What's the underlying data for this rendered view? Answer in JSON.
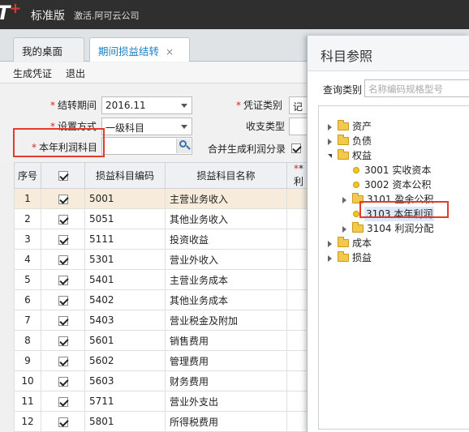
{
  "app": {
    "logo": "T",
    "edition": "标准版",
    "company": "激活.阿可云公司"
  },
  "tabs": [
    {
      "label": "我的桌面"
    },
    {
      "label": "期间损益结转",
      "close": "×"
    }
  ],
  "toolbar": {
    "generate": "生成凭证",
    "exit": "退出"
  },
  "form": {
    "period_label": "结转期间",
    "period_value": "2016.11",
    "voucher_type_label": "凭证类别",
    "voucher_type_value": "记账",
    "setup_label": "设置方式",
    "setup_value": "一级科目",
    "income_type_label": "收支类型",
    "profit_label": "本年利润科目",
    "profit_value": "",
    "merge_label": "合并生成利润分录",
    "merge_checked": true
  },
  "table": {
    "headers": [
      "序号",
      "",
      "损益科目编码",
      "损益科目名称",
      "*利"
    ],
    "rows": [
      {
        "no": "1",
        "code": "5001",
        "name": "主营业务收入",
        "checked": true
      },
      {
        "no": "2",
        "code": "5051",
        "name": "其他业务收入",
        "checked": true
      },
      {
        "no": "3",
        "code": "5111",
        "name": "投资收益",
        "checked": true
      },
      {
        "no": "4",
        "code": "5301",
        "name": "营业外收入",
        "checked": true
      },
      {
        "no": "5",
        "code": "5401",
        "name": "主营业务成本",
        "checked": true
      },
      {
        "no": "6",
        "code": "5402",
        "name": "其他业务成本",
        "checked": true
      },
      {
        "no": "7",
        "code": "5403",
        "name": "营业税金及附加",
        "checked": true
      },
      {
        "no": "8",
        "code": "5601",
        "name": "销售费用",
        "checked": true
      },
      {
        "no": "9",
        "code": "5602",
        "name": "管理费用",
        "checked": true
      },
      {
        "no": "10",
        "code": "5603",
        "name": "财务费用",
        "checked": true
      },
      {
        "no": "11",
        "code": "5711",
        "name": "营业外支出",
        "checked": true
      },
      {
        "no": "12",
        "code": "5801",
        "name": "所得税费用",
        "checked": true
      }
    ]
  },
  "dialog": {
    "title": "科目参照",
    "query_label": "查询类别",
    "query_placeholder": "名称编码规格型号",
    "tree": [
      {
        "label": "资产",
        "type": "folder",
        "state": "closed"
      },
      {
        "label": "负债",
        "type": "folder",
        "state": "closed"
      },
      {
        "label": "权益",
        "type": "folder",
        "state": "open"
      },
      {
        "label": "3001 实收资本",
        "type": "leaf"
      },
      {
        "label": "3002 资本公积",
        "type": "leaf"
      },
      {
        "label": "3101 盈余公积",
        "type": "folder",
        "state": "closed"
      },
      {
        "label": "3103 本年利润",
        "type": "leaf",
        "selected": true
      },
      {
        "label": "3104 利润分配",
        "type": "folder",
        "state": "closed"
      },
      {
        "label": "成本",
        "type": "folder",
        "state": "closed"
      },
      {
        "label": "损益",
        "type": "folder",
        "state": "closed"
      }
    ]
  },
  "colors": {
    "accent": "#1a7fc7",
    "highlight": "#e33b2e",
    "selected_row": "#f7ecdc"
  }
}
